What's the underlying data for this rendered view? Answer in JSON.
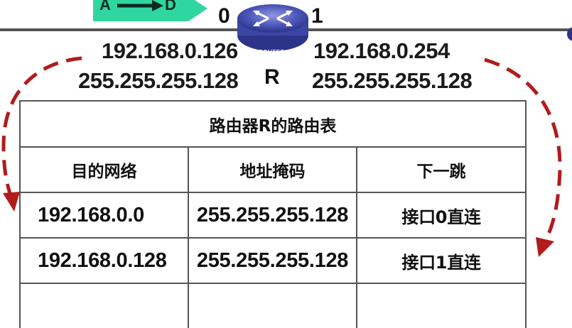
{
  "network": {
    "left_host_label": "A",
    "right_host_label": "D",
    "port_0_label": "0",
    "port_1_label": "1",
    "router_badge": "ROUTER",
    "router_name": "R",
    "port_0_ip": "192.168.0.126",
    "port_0_mask": "255.255.255.128",
    "port_1_ip": "192.168.0.254",
    "port_1_mask": "255.255.255.128"
  },
  "routing_table": {
    "title": "路由器R的路由表",
    "headers": [
      "目的网络",
      "地址掩码",
      "下一跳"
    ],
    "rows": [
      [
        "192.168.0.0",
        "255.255.255.128",
        "接口0直连"
      ],
      [
        "192.168.0.128",
        "255.255.255.128",
        "接口1直连"
      ],
      [
        "",
        "",
        ""
      ]
    ]
  },
  "colors": {
    "arrow_dashes": "#b01c1c",
    "router_body": "#4a55b8",
    "host_box": "#2fd6a0",
    "link_line": "#555555"
  }
}
